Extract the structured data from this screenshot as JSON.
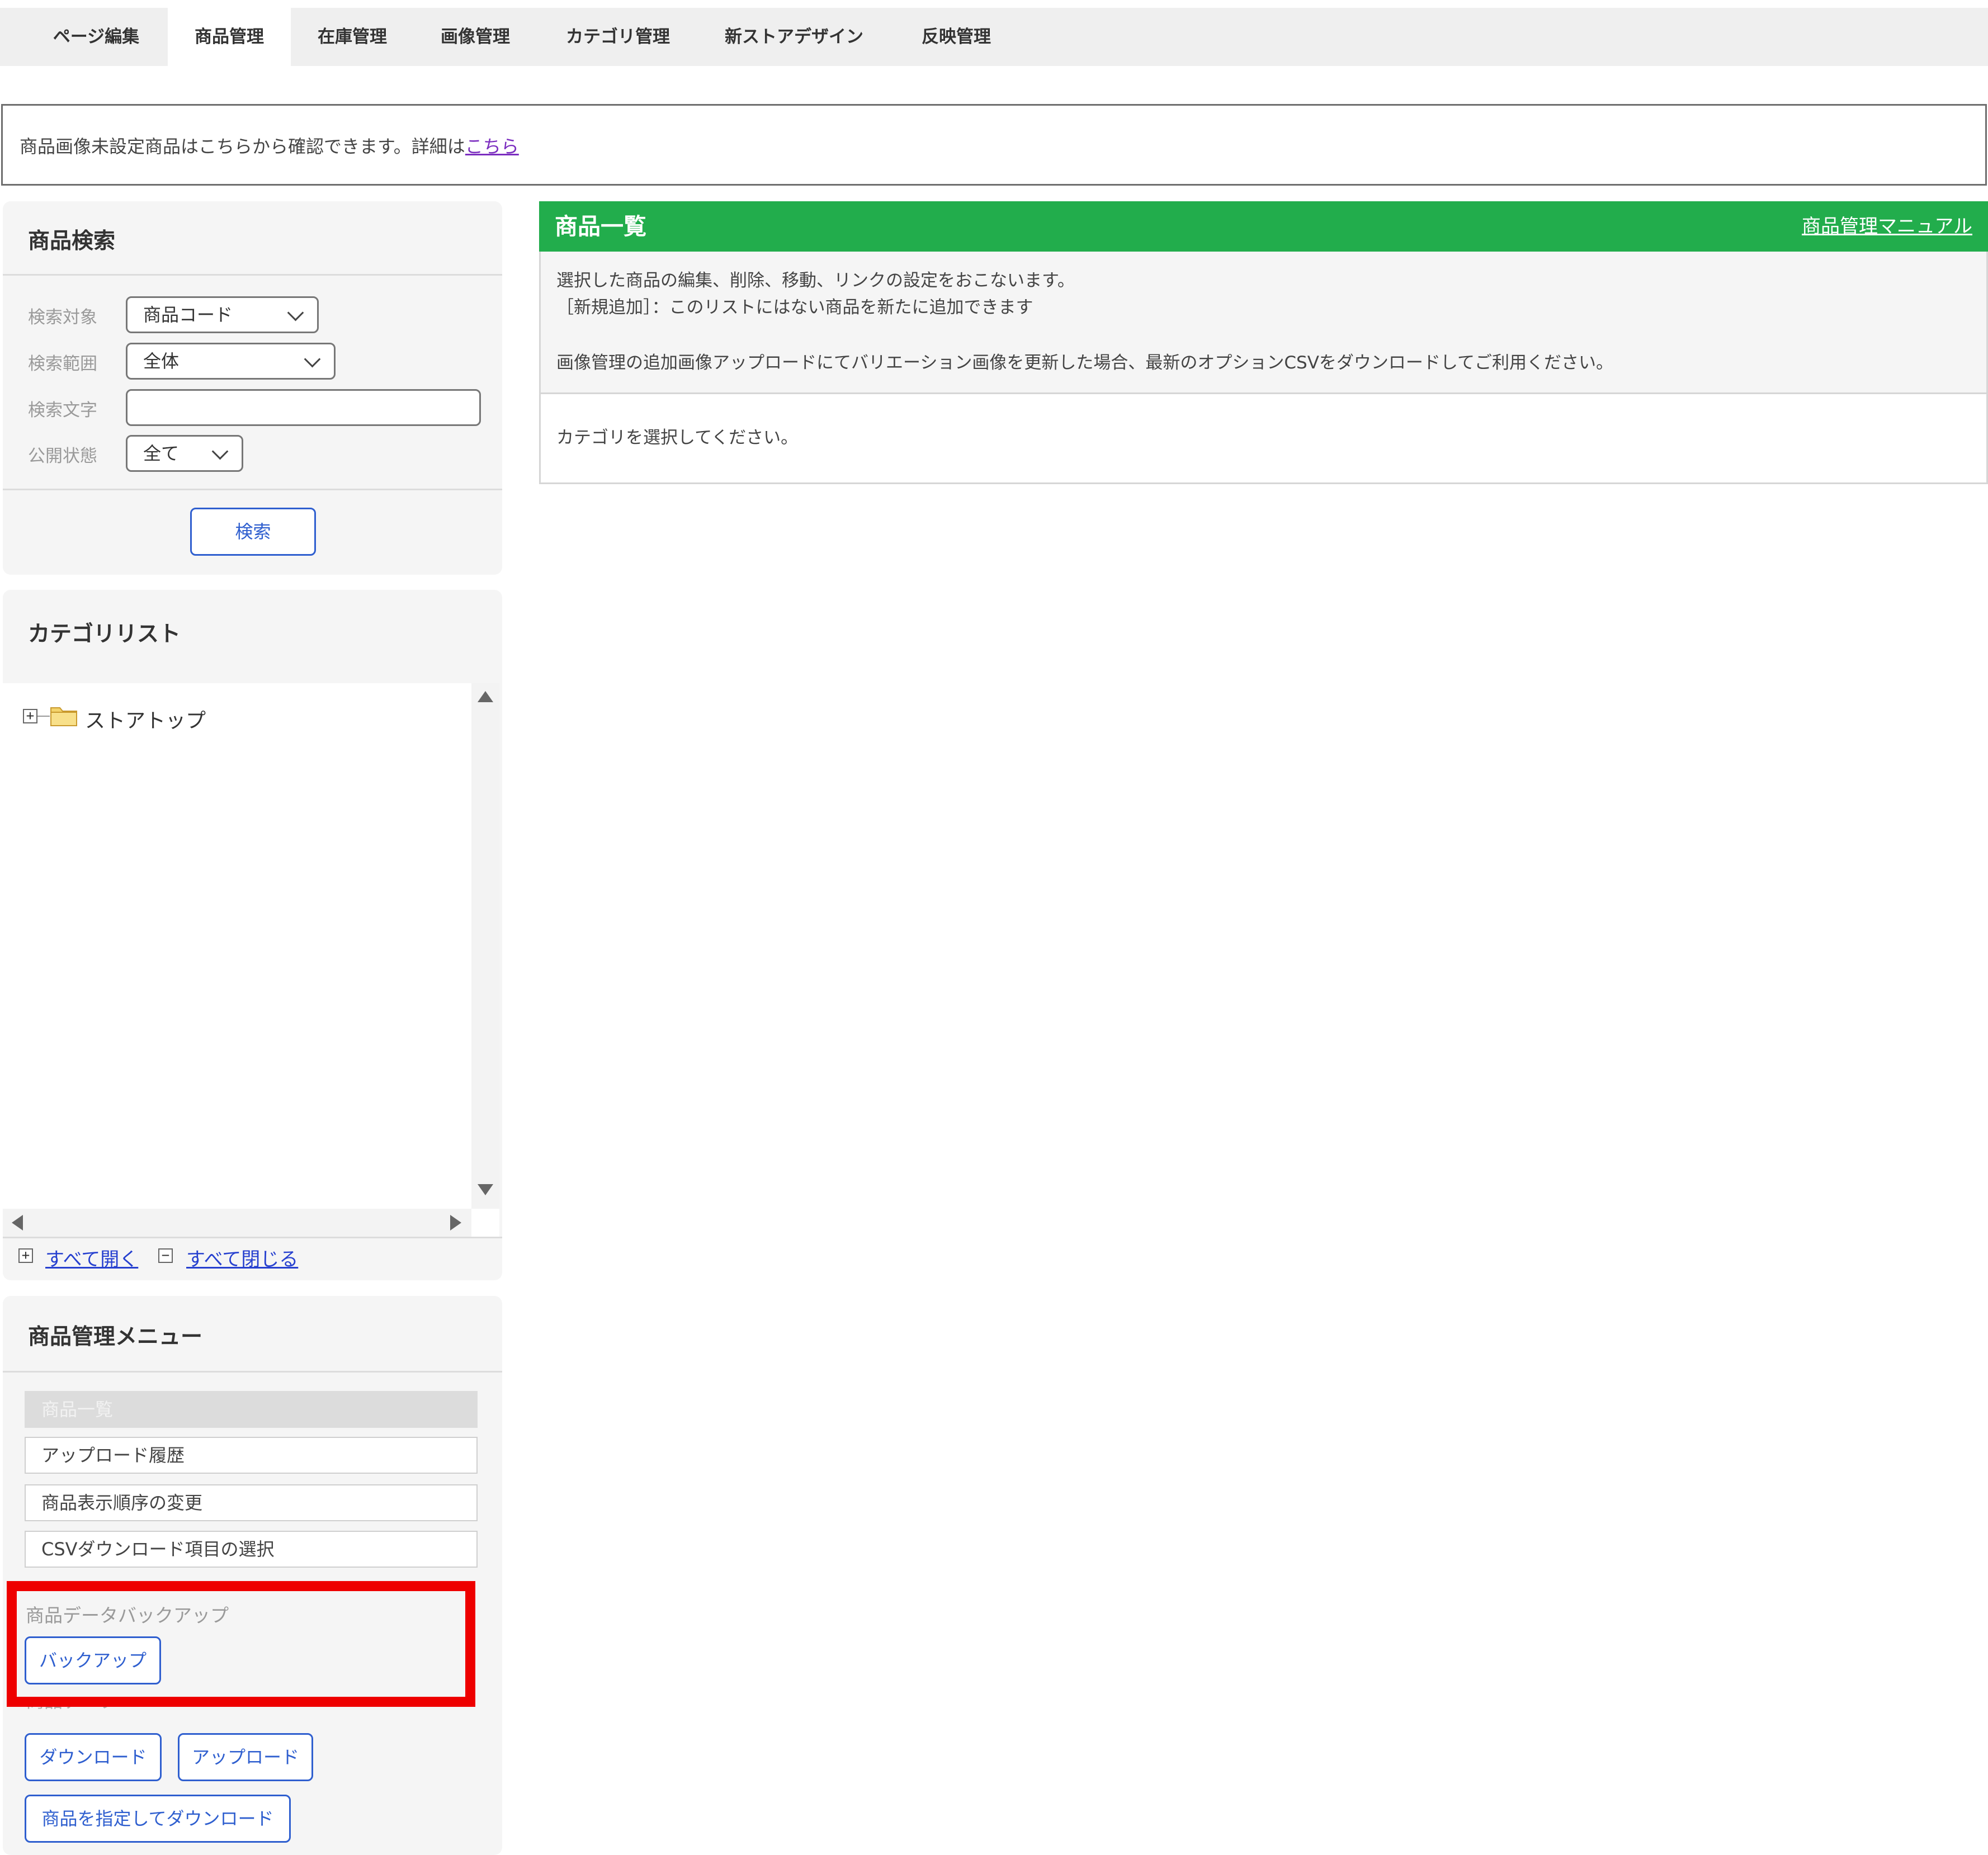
{
  "tabs": [
    {
      "label": "ページ編集",
      "active": false
    },
    {
      "label": "商品管理",
      "active": true
    },
    {
      "label": "在庫管理",
      "active": false
    },
    {
      "label": "画像管理",
      "active": false
    },
    {
      "label": "カテゴリ管理",
      "active": false
    },
    {
      "label": "新ストアデザイン",
      "active": false
    },
    {
      "label": "反映管理",
      "active": false
    }
  ],
  "notice": {
    "text": "商品画像未設定商品はこちらから確認できます。詳細は",
    "link": "こちら"
  },
  "search": {
    "title": "商品検索",
    "target_label": "検索対象",
    "target_value": "商品コード",
    "range_label": "検索範囲",
    "range_value": "全体",
    "text_label": "検索文字",
    "text_value": "",
    "status_label": "公開状態",
    "status_value": "全て",
    "button": "検索"
  },
  "category_list": {
    "title": "カテゴリリスト",
    "root": "ストアトップ",
    "expand_all": "すべて開く",
    "collapse_all": "すべて閉じる"
  },
  "menu": {
    "title": "商品管理メニュー",
    "items": [
      "商品一覧",
      "アップロード履歴",
      "商品表示順序の変更",
      "CSVダウンロード項目の選択"
    ],
    "backup_section": "商品データバックアップ",
    "backup_button": "バックアップ",
    "data_section": "商品データ",
    "download_button": "ダウンロード",
    "upload_button": "アップロード",
    "specified_download_button": "商品を指定してダウンロード"
  },
  "product_list": {
    "title": "商品一覧",
    "manual_link": "商品管理マニュアル",
    "desc_line1": "選択した商品の編集、削除、移動、リンクの設定をおこないます。",
    "desc_line2": "［新規追加］：このリストにはない商品を新たに追加できます",
    "desc_line3": "画像管理の追加画像アップロードにてバリエーション画像を更新した場合、最新のオプションCSVをダウンロードしてご利用ください。",
    "prompt": "カテゴリを選択してください。"
  },
  "colors": {
    "accent_green": "#22ad4c",
    "link_blue": "#2640cf",
    "button_blue": "#2f5fcf",
    "highlight_red": "#ee0000"
  }
}
